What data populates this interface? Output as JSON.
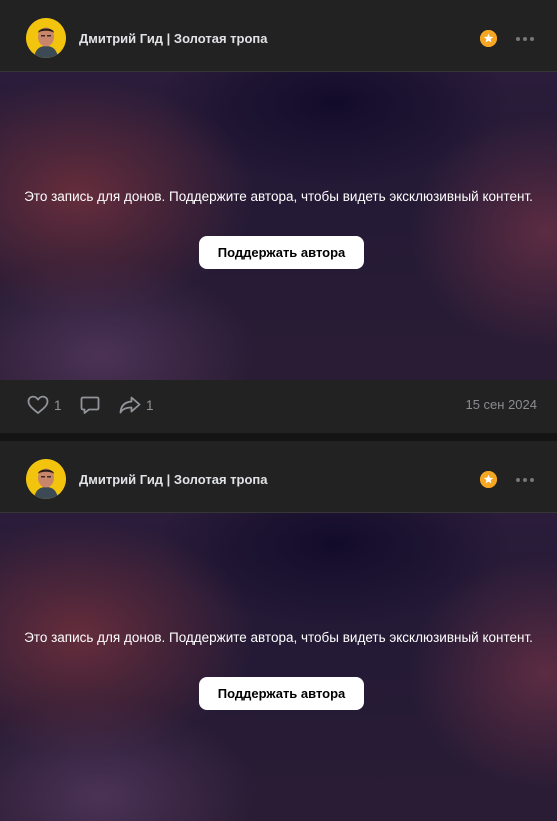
{
  "posts": [
    {
      "author": "Дмитрий Гид | Золотая тропа",
      "paywall_text": "Это запись для донов. Поддержите автора, чтобы видеть эксклюзивный контент.",
      "support_button": "Поддержать автора",
      "likes": "1",
      "shares": "1",
      "date": "15 сен 2024"
    },
    {
      "author": "Дмитрий Гид | Золотая тропа",
      "paywall_text": "Это запись для донов. Поддержите автора, чтобы видеть эксклюзивный контент.",
      "support_button": "Поддержать автора"
    }
  ],
  "icons": {
    "don_badge": "star-badge-icon",
    "more": "more-dots-icon",
    "like": "heart-icon",
    "comment": "comment-icon",
    "share": "share-icon"
  },
  "colors": {
    "card_bg": "#222222",
    "page_bg": "#141414",
    "badge": "#f5a623",
    "avatar_bg": "#f2c40d",
    "button_bg": "#ffffff"
  }
}
